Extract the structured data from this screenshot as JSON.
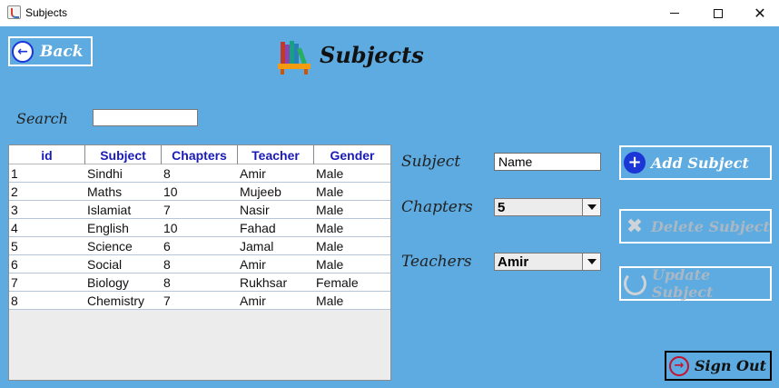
{
  "window": {
    "title": "Subjects",
    "min_glyph": "",
    "max_glyph": "",
    "close_glyph": "✕"
  },
  "header": {
    "back_label": "Back",
    "back_glyph": "←",
    "title": "Subjects",
    "logo_icon": "books-icon"
  },
  "search": {
    "label": "Search",
    "value": ""
  },
  "table": {
    "columns": [
      "id",
      "Subject",
      "Chapters",
      "Teacher",
      "Gender"
    ],
    "rows": [
      [
        "1",
        "Sindhi",
        "8",
        "Amir",
        "Male"
      ],
      [
        "2",
        "Maths",
        "10",
        "Mujeeb",
        "Male"
      ],
      [
        "3",
        "Islamiat",
        "7",
        "Nasir",
        "Male"
      ],
      [
        "4",
        "English",
        "10",
        "Fahad",
        "Male"
      ],
      [
        "5",
        "Science",
        "6",
        "Jamal",
        "Male"
      ],
      [
        "6",
        "Social",
        "8",
        "Amir",
        "Male"
      ],
      [
        "7",
        "Biology",
        "8",
        "Rukhsar",
        "Female"
      ],
      [
        "8",
        "Chemistry",
        "7",
        "Amir",
        "Male"
      ]
    ]
  },
  "form": {
    "subject_label": "Subject",
    "subject_value": "Name",
    "chapters_label": "Chapters",
    "chapters_value": "5",
    "teachers_label": "Teachers",
    "teachers_value": "Amir"
  },
  "actions": {
    "add_label": "Add Subject",
    "add_glyph": "+",
    "delete_label": "Delete Subject",
    "delete_glyph": "✖",
    "update_label": "Update Subject",
    "signout_label": "Sign Out",
    "signout_glyph": "→"
  },
  "colors": {
    "background": "#5dabe0",
    "accent_blue": "#1b35d6",
    "signout_red": "#c7102b",
    "header_text": "#1a1ab8"
  }
}
